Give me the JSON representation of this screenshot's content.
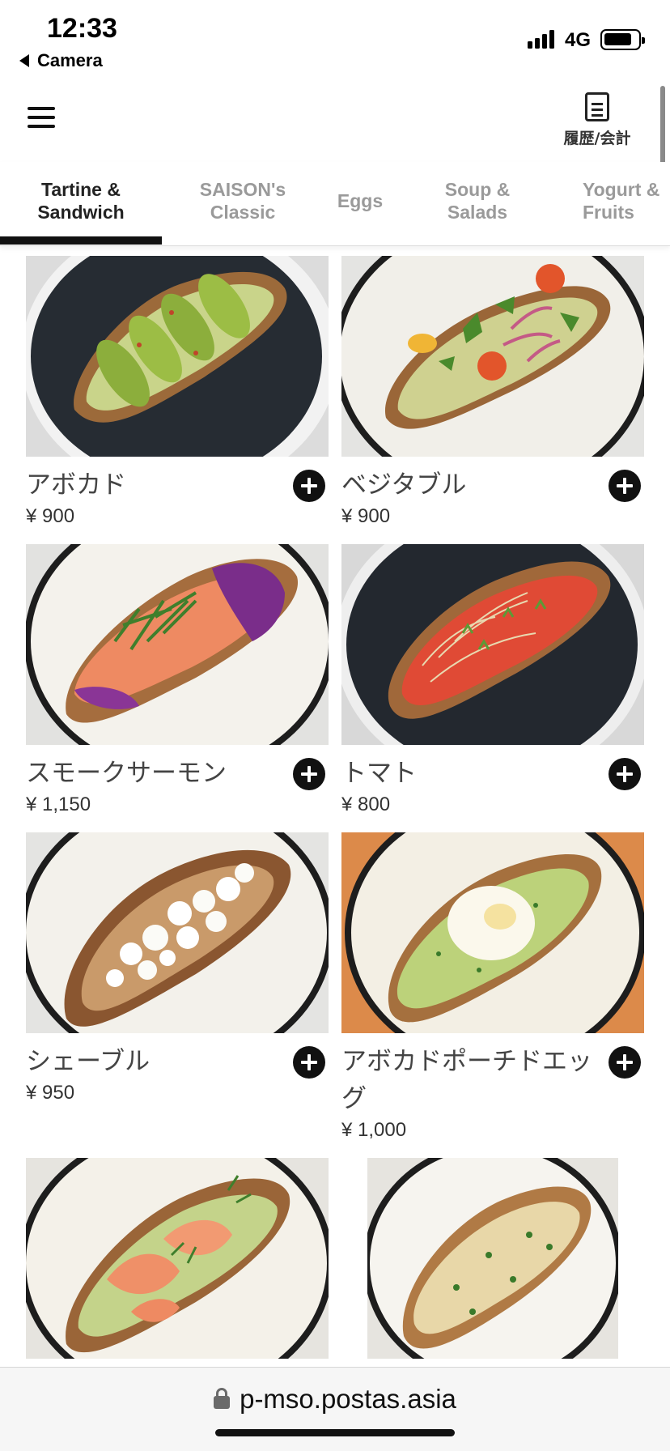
{
  "status_bar": {
    "time": "12:33",
    "back_label": "Camera",
    "network": "4G",
    "signal_icon": "signal-bars-icon",
    "battery_icon": "battery-icon"
  },
  "header": {
    "menu_icon": "hamburger-menu-icon",
    "history_icon": "document-icon",
    "history_label": "履歴/会計"
  },
  "tabs": [
    {
      "label": "Tartine &\nSandwich",
      "active": true
    },
    {
      "label": "SAISON's\nClassic",
      "active": false
    },
    {
      "label": "Eggs",
      "active": false
    },
    {
      "label": "Soup &\nSalads",
      "active": false
    },
    {
      "label": "Yogurt &\nFruits",
      "active": false
    }
  ],
  "products": [
    {
      "name": "アボカド",
      "price": "¥ 900"
    },
    {
      "name": "ベジタブル",
      "price": "¥ 900"
    },
    {
      "name": "スモークサーモン",
      "price": "¥ 1,150"
    },
    {
      "name": "トマト",
      "price": "¥ 800"
    },
    {
      "name": "シェーブル",
      "price": "¥ 950"
    },
    {
      "name": "アボカドポーチドエッグ",
      "price": "¥ 1,000"
    },
    {
      "name": "",
      "price": ""
    },
    {
      "name": "",
      "price": ""
    }
  ],
  "url_bar": {
    "lock_icon": "lock-icon",
    "url": "p-mso.postas.asia"
  },
  "colors": {
    "accent": "#111111",
    "tab_inactive": "#9a9a9a",
    "text": "#444444"
  }
}
